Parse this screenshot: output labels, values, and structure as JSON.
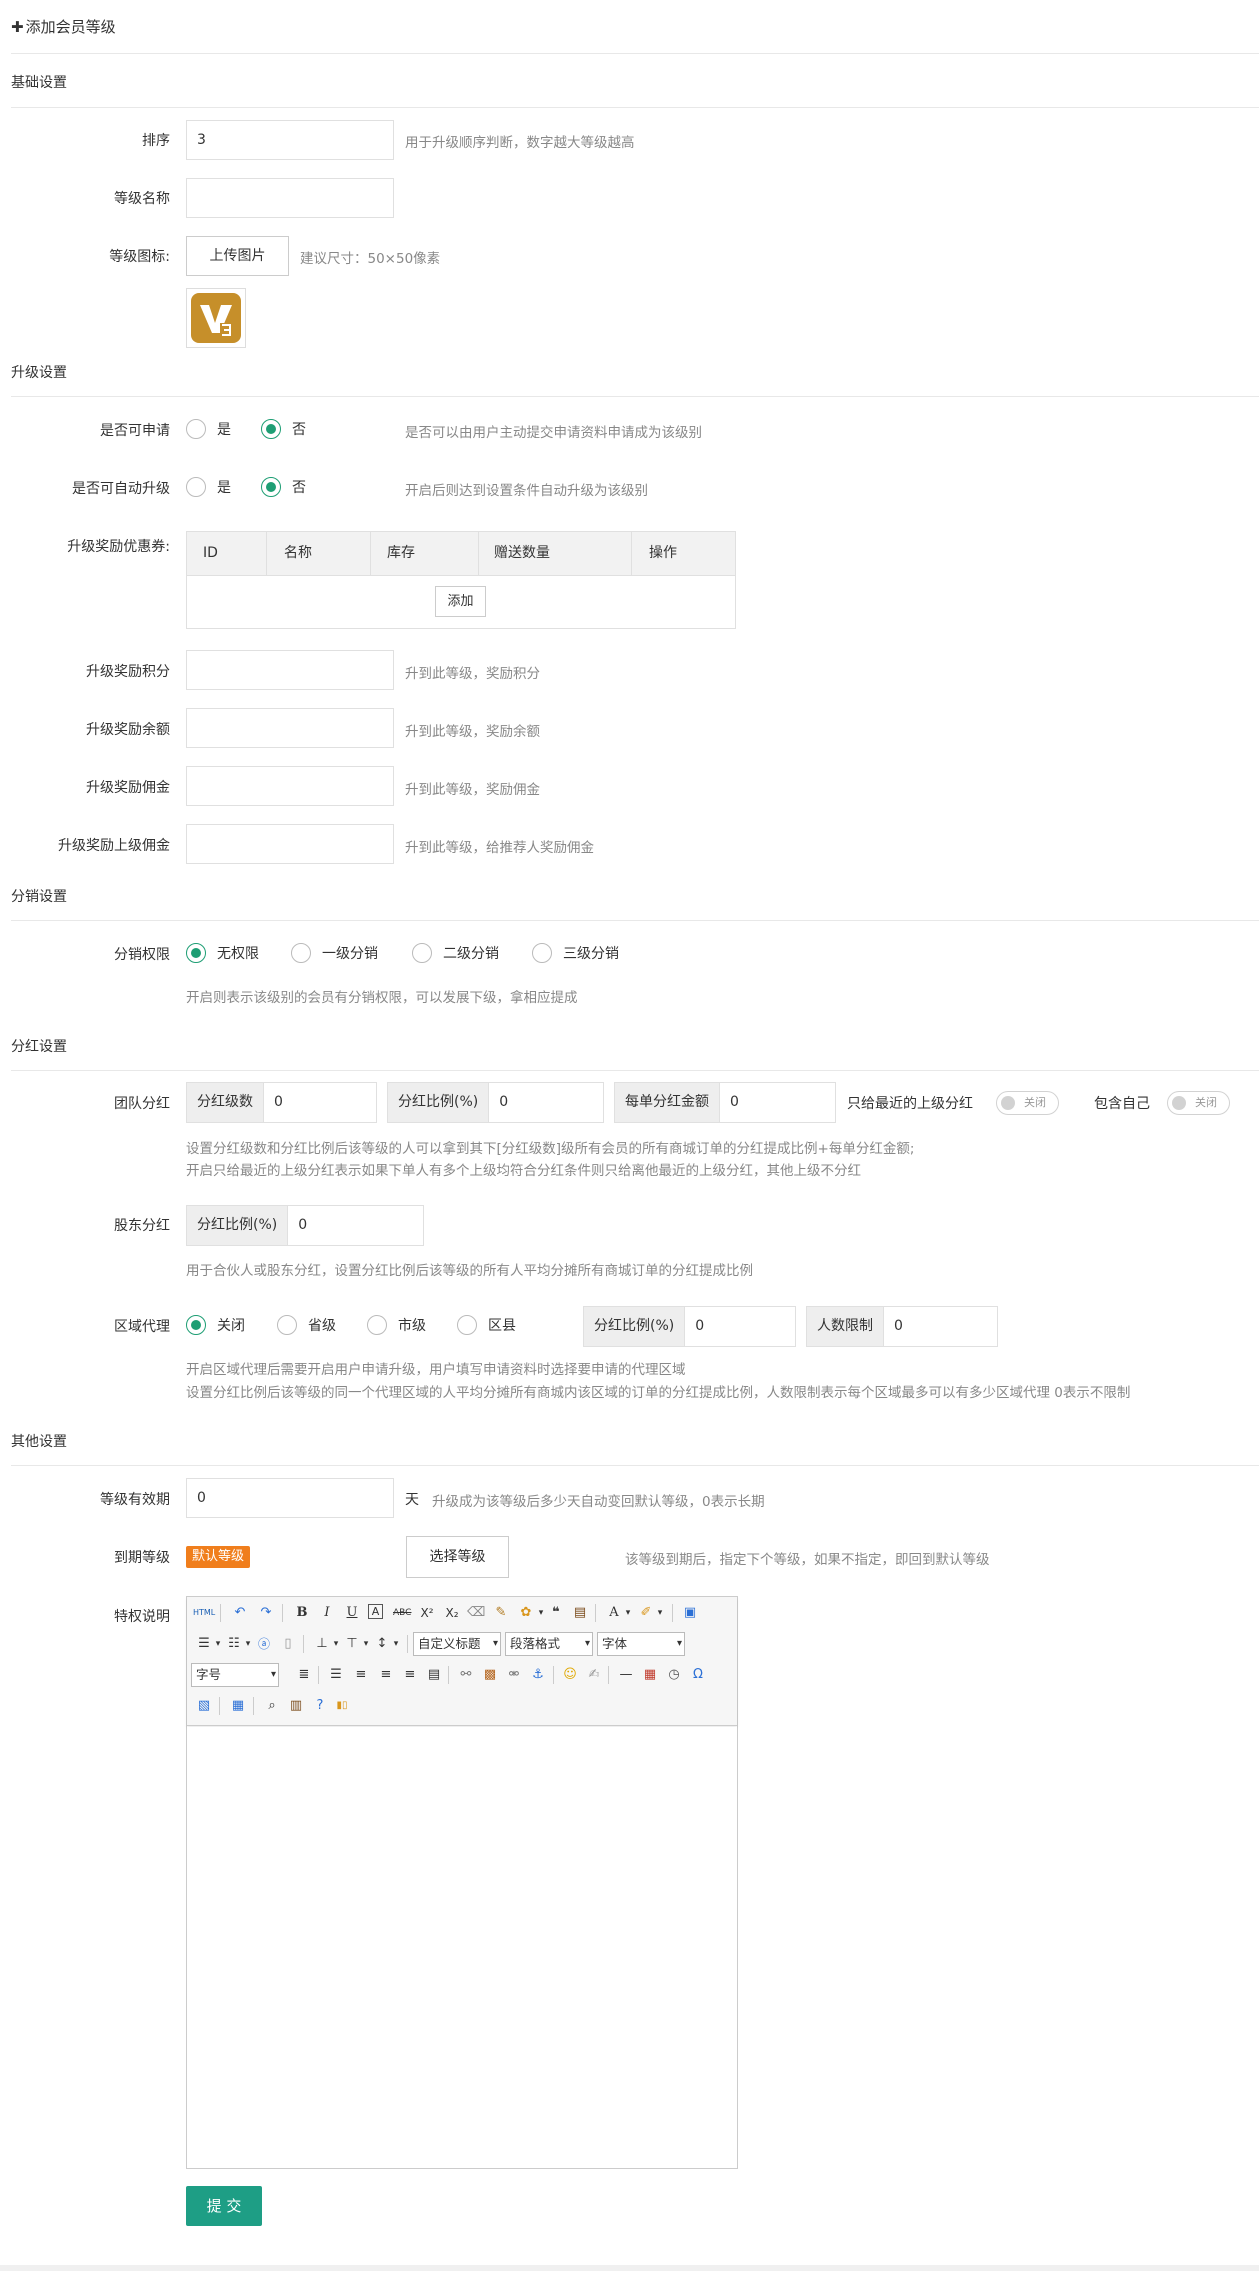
{
  "page": {
    "title": "添加会员等级"
  },
  "sections": {
    "basic": "基础设置",
    "upgrade": "升级设置",
    "distribution": "分销设置",
    "dividend": "分红设置",
    "other": "其他设置"
  },
  "basic": {
    "sort_label": "排序",
    "sort_value": "3",
    "sort_hint": "用于升级顺序判断，数字越大等级越高",
    "name_label": "等级名称",
    "name_value": "",
    "icon_label": "等级图标:",
    "upload_label": "上传图片",
    "icon_hint": "建议尺寸：50×50像素",
    "icon_color": "#c68f2a"
  },
  "upgrade": {
    "apply_label": "是否可申请",
    "yes": "是",
    "no": "否",
    "apply_hint": "是否可以由用户主动提交申请资料申请成为该级别",
    "auto_label": "是否可自动升级",
    "auto_hint": "开启后则达到设置条件自动升级为该级别",
    "coupon_label": "升级奖励优惠券:",
    "coupon_columns": [
      "ID",
      "名称",
      "库存",
      "赠送数量",
      "操作"
    ],
    "add_label": "添加",
    "points_label": "升级奖励积分",
    "points_hint": "升到此等级，奖励积分",
    "balance_label": "升级奖励余额",
    "balance_hint": "升到此等级，奖励余额",
    "commission_label": "升级奖励佣金",
    "commission_hint": "升到此等级，奖励佣金",
    "parent_commission_label": "升级奖励上级佣金",
    "parent_commission_hint": "升到此等级，给推荐人奖励佣金"
  },
  "distribution": {
    "label": "分销权限",
    "options": [
      "无权限",
      "一级分销",
      "二级分销",
      "三级分销"
    ],
    "selected": 0,
    "hint": "开启则表示该级别的会员有分销权限，可以发展下级，拿相应提成"
  },
  "dividend": {
    "team_label": "团队分红",
    "team_level_addon": "分红级数",
    "team_level_value": "0",
    "team_ratio_addon": "分红比例(%)",
    "team_ratio_value": "0",
    "team_amount_addon": "每单分红金额",
    "team_amount_value": "0",
    "nearest_label": "只给最近的上级分红",
    "switch_off": "关闭",
    "include_self_label": "包含自己",
    "team_hint1": "设置分红级数和分红比例后该等级的人可以拿到其下[分红级数]级所有会员的所有商城订单的分红提成比例+每单分红金额;",
    "team_hint2": "开启只给最近的上级分红表示如果下单人有多个上级均符合分红条件则只给离他最近的上级分红，其他上级不分红",
    "shareholder_label": "股东分红",
    "shareholder_addon": "分红比例(%)",
    "shareholder_value": "0",
    "shareholder_hint": "用于合伙人或股东分红，设置分红比例后该等级的所有人平均分摊所有商城订单的分红提成比例",
    "region_label": "区域代理",
    "region_options": [
      "关闭",
      "省级",
      "市级",
      "区县"
    ],
    "region_selected": 0,
    "region_ratio_addon": "分红比例(%)",
    "region_ratio_value": "0",
    "region_limit_addon": "人数限制",
    "region_limit_value": "0",
    "region_hint1": "开启区域代理后需要开启用户申请升级，用户填写申请资料时选择要申请的代理区域",
    "region_hint2": "设置分红比例后该等级的同一个代理区域的人平均分摊所有商城内该区域的订单的分红提成比例，人数限制表示每个区域最多可以有多少区域代理 0表示不限制"
  },
  "other": {
    "valid_label": "等级有效期",
    "valid_value": "0",
    "valid_unit": "天",
    "valid_hint": "升级成为该等级后多少天自动变回默认等级，0表示长期",
    "expire_label": "到期等级",
    "expire_badge": "默认等级",
    "select_level_label": "选择等级",
    "expire_hint": "该等级到期后，指定下个等级，如果不指定，即回到默认等级",
    "privilege_label": "特权说明",
    "editor": {
      "custom_title": "自定义标题",
      "paragraph": "段落格式",
      "font_family": "字体",
      "font_size": "字号"
    },
    "submit_label": "提 交"
  },
  "colors": {
    "accent": "#1e9e74",
    "submit": "#1e9e85",
    "badge": "#f07e1c"
  }
}
